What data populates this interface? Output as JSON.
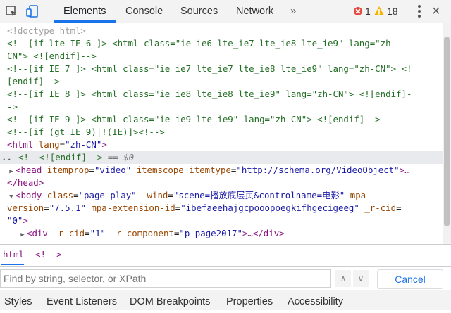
{
  "toolbar": {
    "tabs": [
      "Elements",
      "Console",
      "Sources",
      "Network"
    ],
    "more": "»",
    "errors": "1",
    "warnings": "18",
    "close": "×"
  },
  "code": {
    "l1": "<!doctype html>",
    "l2": "<!--[if lte IE 6 ]> <html class=\"ie ie6 lte_ie7 lte_ie8 lte_ie9\" lang=\"zh-",
    "l3": "CN\"> <![endif]-->",
    "l4": "<!--[if IE 7 ]> <html class=\"ie ie7 lte_ie7 lte_ie8 lte_ie9\" lang=\"zh-CN\"> <!",
    "l5": "[endif]-->",
    "l6": "<!--[if IE 8 ]> <html class=\"ie ie8 lte_ie8 lte_ie9\" lang=\"zh-CN\"> <![endif]-",
    "l7": "->",
    "l8": "<!--[if IE 9 ]> <html class=\"ie ie9 lte_ie9\" lang=\"zh-CN\"> <![endif]-->",
    "l9": "<!--[if (gt IE 9)|!(IE)]><!-->",
    "html_tag": "html",
    "html_attr": "lang",
    "html_val": "\"zh-CN\"",
    "sel_comment": "<!--<![endif]-->",
    "sel_marker": "== $0",
    "head_tag": "head",
    "head_a1": "itemprop",
    "head_v1": "\"video\"",
    "head_a2": "itemscope",
    "head_a3": "itemtype",
    "head_v3": "\"http://schema.org/VideoObject\"",
    "head_rest": ">…",
    "head_close": "</head>",
    "body_tag": "body",
    "body_a1": "class",
    "body_v1": "\"page_play\"",
    "body_a2": "_wind",
    "body_v2": "\"scene=播放底层页&controlname=电影\"",
    "body_a3": "mpa-",
    "body_a3b": "version",
    "body_v3": "\"7.5.1\"",
    "body_a4": "mpa-extension-id",
    "body_v4": "\"ibefaeehajgcpooopoegkifhgecigeeg\"",
    "body_a5": "_r-cid",
    "body_v5": "\"0\"",
    "div_tag": "div",
    "div_a1": "_r-cid",
    "div_v1": "\"1\"",
    "div_a2": "_r-component",
    "div_v2": "\"p-page2017\"",
    "div_rest": ">…</div>",
    "dots": ".."
  },
  "breadcrumbs": [
    "html",
    "<!-->"
  ],
  "find": {
    "placeholder": "Find by string, selector, or XPath",
    "cancel": "Cancel"
  },
  "bottom_tabs": [
    "Styles",
    "Event Listeners",
    "DOM Breakpoints",
    "Properties",
    "Accessibility"
  ]
}
